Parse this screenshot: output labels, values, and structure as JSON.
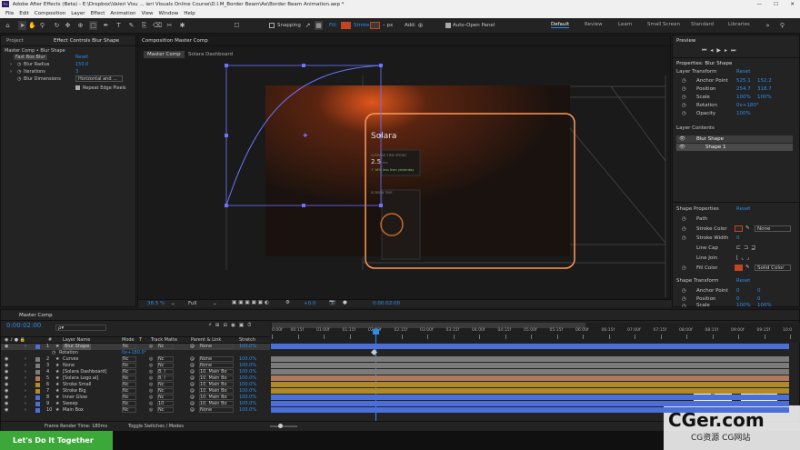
{
  "title_bar": "Adobe After Effects (Beta) - E:\\Dropbox\\Valeri Visu ... ieri Visuals Online Course\\D.I.M_Border Beam\\Ae\\Border Beam Animation.aep *",
  "menu": [
    "File",
    "Edit",
    "Composition",
    "Layer",
    "Effect",
    "Animation",
    "View",
    "Window",
    "Help"
  ],
  "toolbar": {
    "snapping": "Snapping",
    "fill": "Fill:",
    "stroke": "Stroke:",
    "px": "– px",
    "add": "Add:",
    "auto_open": "Auto-Open Panel",
    "workspaces": [
      "Default",
      "Review",
      "Learn",
      "Small Screen",
      "Standard",
      "Libraries"
    ],
    "fill_color": "#c2451f",
    "stroke_color": "#3a3a3a"
  },
  "left_panel": {
    "tab1": "Project",
    "tab2": "Effect Controls Blur Shape",
    "breadcrumb": "Master Comp • Blur Shape",
    "effect": "Fast Box Blur",
    "reset": "Reset",
    "params": [
      {
        "label": "Blur Radius",
        "value": "150.0"
      },
      {
        "label": "Iterations",
        "value": "3"
      },
      {
        "label": "Blur Dimensions",
        "value": "Horizontal and ..."
      }
    ],
    "repeat": "Repeat Edge Pixels"
  },
  "comp": {
    "panel_title": "Composition Master Comp",
    "tabs": [
      "Master Comp",
      "Solara Dashboard"
    ],
    "zoom": "38.5 %",
    "quality": "Full",
    "offset": "+0.0",
    "timecode": "0:00:02:00",
    "logo": "Solara",
    "stat_label": "AVERAGE TIME SPEND",
    "stat_value": "2.5",
    "stat_unit": "hrs",
    "stat_delta": "↑ 16% less than yesterday",
    "screen_time": "SCREEN TIME"
  },
  "right_panel": {
    "tab1": "Preview",
    "section_title": "Properties: Blur Shape",
    "layer_transform": "Layer Transform",
    "reset": "Reset",
    "transform": [
      {
        "label": "Anchor Point",
        "v1": "525.1",
        "v2": "152.2"
      },
      {
        "label": "Position",
        "v1": "254.7",
        "v2": "318.7"
      },
      {
        "label": "Scale",
        "v1": "100%",
        "v2": "100%"
      },
      {
        "label": "Rotation",
        "v1": "0x+180°",
        "v2": ""
      },
      {
        "label": "Opacity",
        "v1": "100%",
        "v2": ""
      }
    ],
    "layer_contents": "Layer Contents",
    "contents": [
      "Blur Shape",
      "Shape 1"
    ],
    "shape_props": "Shape Properties",
    "shape_rows": [
      "Path",
      "Stroke Color",
      "Stroke Width",
      "Line Cap",
      "Line Join",
      "Fill Color"
    ],
    "none_label": "None",
    "stroke_width_value": "0",
    "solid_color": "Solid Color",
    "shape_transform": "Shape Transform",
    "shape_transform_rows": [
      {
        "label": "Anchor Point",
        "v1": "0",
        "v2": "0"
      },
      {
        "label": "Position",
        "v1": "0",
        "v2": "0"
      },
      {
        "label": "Scale",
        "v1": "100%",
        "v2": "100%"
      }
    ]
  },
  "timeline": {
    "tab": "Master Comp",
    "timecode": "0:00:02:00",
    "search_placeholder": "ρ▾",
    "headers": [
      "#",
      "Layer Name",
      "Mode",
      "T",
      "Track Matte",
      "Parent & Link",
      "Stretch"
    ],
    "ruler": [
      "0:00f",
      "00:15f",
      "01:00f",
      "01:15f",
      "02:00f",
      "02:15f",
      "03:00f",
      "03:15f",
      "04:00f",
      "04:15f",
      "05:00f",
      "05:15f",
      "06:00f",
      "06:15f",
      "07:00f",
      "07:15f",
      "08:00f",
      "08:15f",
      "09:00f",
      "09:15f",
      "10:0"
    ],
    "rotation_label": "Rotation",
    "rotation_value": "0x+180.0°",
    "layers": [
      {
        "n": "1",
        "name": "Blur Shape",
        "mode": "Nc",
        "matte": "Nc",
        "parent": "None",
        "stretch": "100.0%",
        "color": "#4a6fd6"
      },
      {
        "n": "2",
        "name": "Curves",
        "mode": "Nc",
        "matte": "Nc",
        "parent": "None",
        "stretch": "100.0%",
        "color": "#7b7b7b"
      },
      {
        "n": "3",
        "name": "None",
        "mode": "Nc",
        "matte": "Nc",
        "parent": "None",
        "stretch": "100.0%",
        "color": "#7b7b7b"
      },
      {
        "n": "4",
        "name": "[Solara Dashboard]",
        "mode": "Nc",
        "matte": "8. l",
        "parent": "10. Main Bo",
        "stretch": "100.0%",
        "color": "#7b7b7b"
      },
      {
        "n": "5",
        "name": "[Solara Logo.ai]",
        "mode": "Nc",
        "matte": "8. l",
        "parent": "10. Main Bo",
        "stretch": "100.0%",
        "color": "#b0785c"
      },
      {
        "n": "6",
        "name": "Stroke Small",
        "mode": "Nc",
        "matte": "Nc",
        "parent": "10. Main Bo",
        "stretch": "100.0%",
        "color": "#b08a2a"
      },
      {
        "n": "7",
        "name": "Stroke Big",
        "mode": "Nc",
        "matte": "Nc",
        "parent": "10. Main Bo",
        "stretch": "100.0%",
        "color": "#b08a2a"
      },
      {
        "n": "8",
        "name": "Inner Glow",
        "mode": "Nc",
        "matte": "Nc",
        "parent": "10. Main Bo",
        "stretch": "100.0%",
        "color": "#4a6fd6"
      },
      {
        "n": "9",
        "name": "Sweep",
        "mode": "Nc",
        "matte": "10",
        "parent": "10. Main Bo",
        "stretch": "100.0%",
        "color": "#4a6fd6"
      },
      {
        "n": "10",
        "name": "Main Box",
        "mode": "Nc",
        "matte": "Nc",
        "parent": "None",
        "stretch": "100.0%",
        "color": "#4a6fd6"
      }
    ],
    "footer_left": "Frame Render Time: 180ms",
    "footer_mid": "Toggle Switches / Modes"
  },
  "banner": "Let's Do It Together",
  "watermark": {
    "main": "CGer.com",
    "sub": "CG资源 CG网站"
  }
}
